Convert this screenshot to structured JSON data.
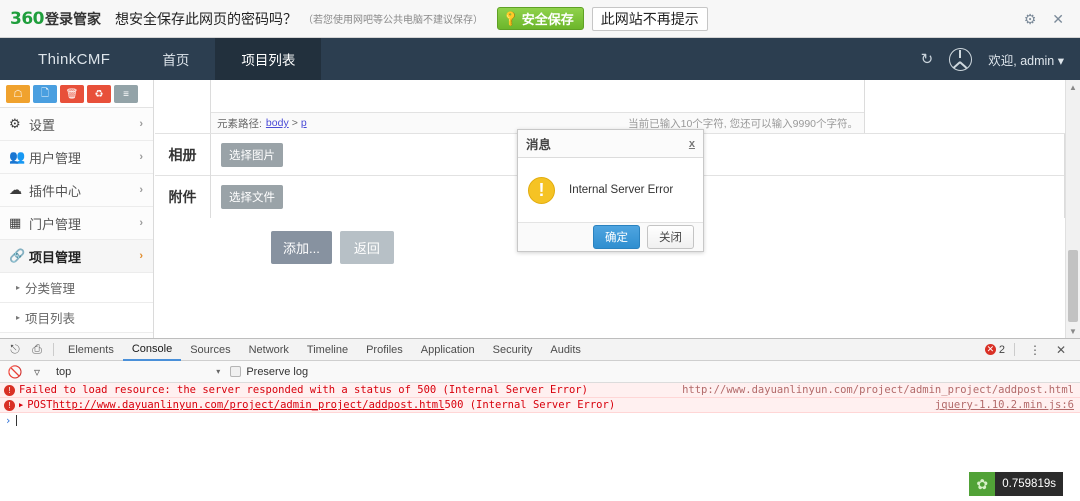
{
  "notification_bar": {
    "brand_en": "360",
    "brand_cn": "登录管家",
    "question": "想安全保存此网页的密码吗？",
    "hint": "（若您使用网吧等公共电脑不建议保存）",
    "save_button": "安全保存",
    "never_button": "此网站不再提示",
    "key_icon": "key-icon",
    "gear_icon": "gear-icon",
    "close_icon": "close-icon"
  },
  "navbar": {
    "logo": "ThinkCMF",
    "items": [
      {
        "label": "首页",
        "active": false
      },
      {
        "label": "项目列表",
        "active": true
      }
    ],
    "refresh_icon": "refresh-icon",
    "avatar_icon": "avatar-icon",
    "user_text": "欢迎, admin ▾"
  },
  "sidebar": {
    "quick_icons": [
      {
        "name": "home-icon",
        "glyph": "⌂",
        "color": "#f0a22e"
      },
      {
        "name": "file-icon",
        "glyph": "🗋",
        "color": "#4a9fe0"
      },
      {
        "name": "trash-icon",
        "glyph": "🗑",
        "color": "#e8503a"
      },
      {
        "name": "refresh-icon",
        "glyph": "⟳",
        "color": "#e8503a"
      },
      {
        "name": "list-icon",
        "glyph": "≡",
        "color": "#93a3a8"
      }
    ],
    "items": [
      {
        "label": "设置",
        "icon": "gear-icon",
        "glyph": "⚙",
        "chevron": "›",
        "active": false
      },
      {
        "label": "用户管理",
        "icon": "users-icon",
        "glyph": "👥",
        "chevron": "›",
        "active": false
      },
      {
        "label": "插件中心",
        "icon": "cloud-icon",
        "glyph": "☁",
        "chevron": "›",
        "active": false
      },
      {
        "label": "门户管理",
        "icon": "grid-icon",
        "glyph": "▦",
        "chevron": "›",
        "active": false
      },
      {
        "label": "项目管理",
        "icon": "link-icon",
        "glyph": "⛓",
        "chevron": "›",
        "active": true
      }
    ],
    "sub_items": [
      {
        "label": "分类管理",
        "marker": "▸"
      },
      {
        "label": "项目列表",
        "marker": "▸"
      }
    ]
  },
  "content": {
    "editor_path_label": "元素路径:",
    "editor_path_body": "body",
    "editor_path_sep": ">",
    "editor_path_p": "p",
    "editor_count": "当前已输入10个字符, 您还可以输入9990个字符。",
    "rows": [
      {
        "label": "相册",
        "button": "选择图片"
      },
      {
        "label": "附件",
        "button": "选择文件"
      }
    ],
    "submit_button": "添加...",
    "back_button": "返回"
  },
  "dialog": {
    "title": "消息",
    "close_label": "x",
    "warn_icon": "warning-icon",
    "warn_glyph": "!",
    "message": "Internal Server Error",
    "ok_button": "确定",
    "cancel_button": "关闭"
  },
  "timer_badge": {
    "leaf_icon": "leaf-icon",
    "time": "0.759819s"
  },
  "devtools": {
    "inspect_icon": "inspect-element-icon",
    "device_icon": "device-toolbar-icon",
    "tabs": [
      {
        "label": "Elements",
        "active": false
      },
      {
        "label": "Console",
        "active": true
      },
      {
        "label": "Sources",
        "active": false
      },
      {
        "label": "Network",
        "active": false
      },
      {
        "label": "Timeline",
        "active": false
      },
      {
        "label": "Profiles",
        "active": false
      },
      {
        "label": "Application",
        "active": false
      },
      {
        "label": "Security",
        "active": false
      },
      {
        "label": "Audits",
        "active": false
      }
    ],
    "error_count": "2",
    "error_icon": "error-circle-icon",
    "menu_icon": "kebab-menu-icon",
    "close_icon": "close-icon",
    "clear_icon": "clear-console-icon",
    "filter_icon": "filter-icon",
    "context": "top",
    "context_caret": "▾",
    "preserve_log_label": "Preserve log",
    "console_rows": [
      {
        "error_glyph": "!",
        "expander": "",
        "text": "Failed to load resource: the server responded with a status of 500 (Internal Server Error)",
        "link": "",
        "tail": "",
        "source": "http://www.dayuanlinyun.com/project/admin_project/addpost.html",
        "source_underlined": false
      },
      {
        "error_glyph": "!",
        "expander": "▶",
        "text": "POST ",
        "link": "http://www.dayuanlinyun.com/project/admin_project/addpost.html",
        "tail": " 500 (Internal Server Error)",
        "source": "jquery-1.10.2.min.js:6",
        "source_underlined": true
      }
    ],
    "prompt_caret": "›"
  },
  "scrollbar": {
    "up_arrow": "▲",
    "down_arrow": "▼"
  },
  "colors": {
    "navbar_bg": "#2c3e50",
    "navbar_active": "#22303d",
    "green_accent": "#6cb62b",
    "blue_accent": "#2f8fd0",
    "error_red": "#d93025",
    "warn_yellow": "#f5c324"
  }
}
